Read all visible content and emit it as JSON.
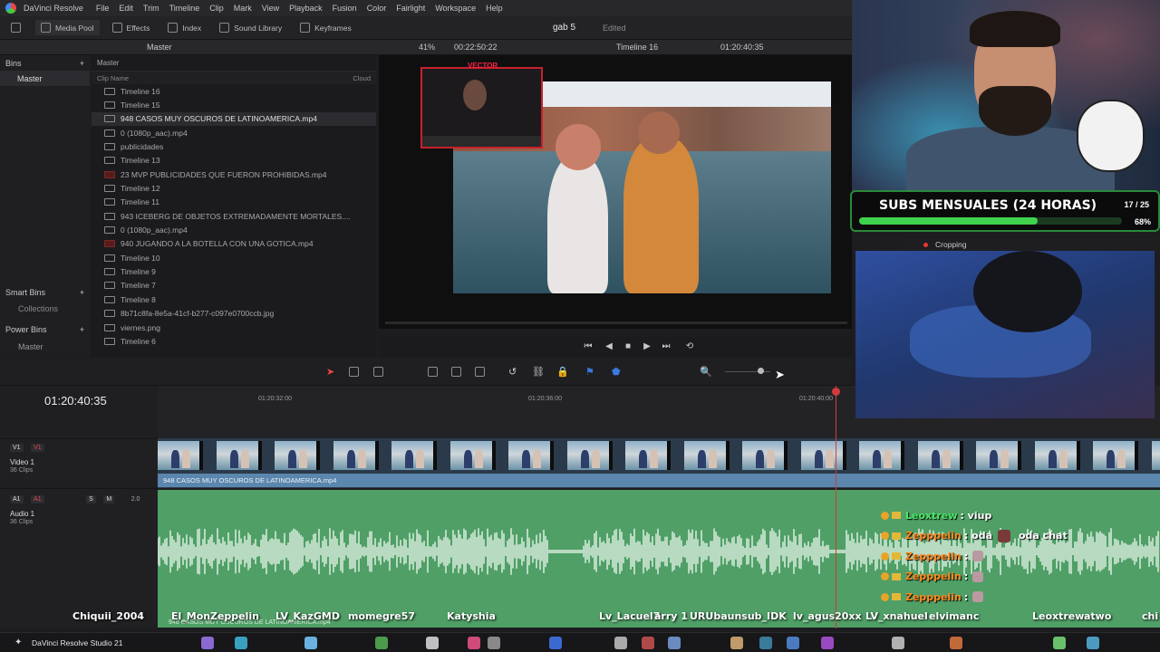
{
  "app": {
    "title": "DaVinci Resolve",
    "project_name": "gab 5",
    "project_status": "Edited"
  },
  "menu": [
    "File",
    "Edit",
    "Trim",
    "Timeline",
    "Clip",
    "Mark",
    "View",
    "Playback",
    "Fusion",
    "Color",
    "Fairlight",
    "Workspace",
    "Help"
  ],
  "toolbar": {
    "media_pool": "Media Pool",
    "effects": "Effects",
    "index": "Index",
    "sound_library": "Sound Library",
    "keyframes": "Keyframes"
  },
  "bar2": {
    "master": "Master",
    "zoom": "41%",
    "duration": "00:22:50:22",
    "timeline_name": "Timeline 16",
    "timecode": "01:20:40:35"
  },
  "bins": {
    "header": "Bins",
    "master": "Master",
    "smart_bins": "Smart Bins",
    "collections": "Collections",
    "power_bins": "Power Bins",
    "power_master": "Master"
  },
  "cliplist": {
    "header": "Master",
    "col_name": "Clip Name",
    "col_cloud": "Cloud",
    "clips": [
      {
        "name": "Timeline 16",
        "kind": "timeline"
      },
      {
        "name": "Timeline 15",
        "kind": "timeline"
      },
      {
        "name": "948 CASOS MUY OSCUROS DE LATINOAMERICA.mp4",
        "kind": "video",
        "selected": true
      },
      {
        "name": "0 (1080p_aac).mp4",
        "kind": "video"
      },
      {
        "name": "publicidades",
        "kind": "timeline"
      },
      {
        "name": "Timeline 13",
        "kind": "timeline"
      },
      {
        "name": "23 MVP PUBLICIDADES QUE FUERON PROHIBIDAS.mp4",
        "kind": "red"
      },
      {
        "name": "Timeline 12",
        "kind": "timeline"
      },
      {
        "name": "Timeline 11",
        "kind": "timeline"
      },
      {
        "name": "943 ICEBERG DE OBJETOS EXTREMADAMENTE MORTALES....",
        "kind": "video"
      },
      {
        "name": "0 (1080p_aac).mp4",
        "kind": "video"
      },
      {
        "name": "940 JUGANDO A LA BOTELLA CON UNA GOTICA.mp4",
        "kind": "red"
      },
      {
        "name": "Timeline 10",
        "kind": "timeline"
      },
      {
        "name": "Timeline 9",
        "kind": "timeline"
      },
      {
        "name": "Timeline 7",
        "kind": "timeline"
      },
      {
        "name": "Timeline 8",
        "kind": "timeline"
      },
      {
        "name": "8b71c8fa-8e5a-41cf-b277-c097e0700ccb.jpg",
        "kind": "image"
      },
      {
        "name": "viernes.png",
        "kind": "image"
      },
      {
        "name": "Timeline 6",
        "kind": "timeline"
      }
    ]
  },
  "viewer": {
    "pip_title": "VECTOR"
  },
  "timeline": {
    "timecode": "01:20:40:35",
    "ruler": [
      "01:20:32:00",
      "01:20:36:00",
      "01:20:40:00"
    ],
    "video_track": {
      "tag1": "V1",
      "tag2": "V1",
      "name": "Video 1",
      "count": "36 Clips"
    },
    "audio_track": {
      "tag1": "A1",
      "tag2": "A1",
      "name": "Audio 1",
      "count": "36 Clips",
      "level": "2.0",
      "s": "S",
      "m": "M"
    },
    "clip_label": "948 CASOS MUY OSCUROS DE LATINOAMERICA.mp4",
    "audio_label": "948 CASOS MUY OSCUROS DE LATINOAMERICA.mp4"
  },
  "overlay": {
    "subs_title": "SUBS MENSUALES (24 HORAS)",
    "subs_count": "17 / 25",
    "subs_percent": "68%",
    "subs_progress": 0.68,
    "cropping": "Cropping"
  },
  "chat": [
    {
      "user": "Leoxtrew",
      "text": ": viup",
      "color": "green"
    },
    {
      "user": "Zepppelin",
      "text": ": oda",
      "extra": "oda chat",
      "color": "orange"
    },
    {
      "user": "Zepppelin",
      "text": ":",
      "color": "orange"
    },
    {
      "user": "Zepppelin",
      "text": ":",
      "color": "orange"
    },
    {
      "user": "Zepppelin",
      "text": ":",
      "color": "orange"
    }
  ],
  "names": [
    "Chiquii_2004",
    "El_Mon",
    "Zeppelin",
    "LV_KazGMD",
    "momegre57",
    "Katyshia",
    "Lv_Lacuel7",
    "arry 1",
    "URUbaunsub_IDK",
    "lv_agus20xx",
    "LV_xnahuel",
    "elvimanc",
    "Leoxtrew",
    "atwo",
    "chi"
  ],
  "taskbar": {
    "app_label": "DaVinci Resolve Studio 21"
  }
}
